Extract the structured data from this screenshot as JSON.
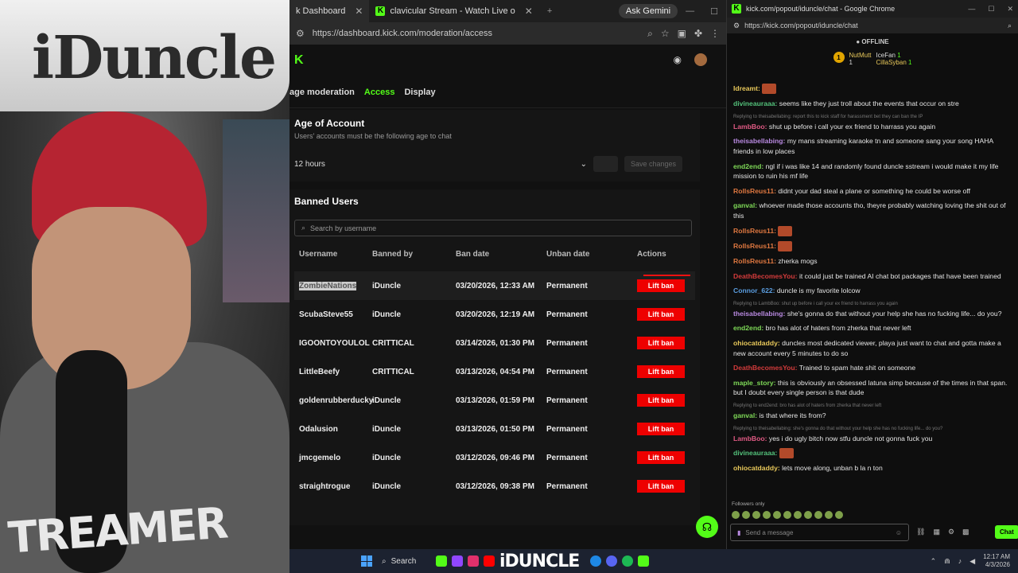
{
  "webcam": {
    "cap_text": "iDuncle",
    "shirt_text": "TREAMER"
  },
  "browser1": {
    "tabs": [
      {
        "label": "k Dashboard"
      },
      {
        "label": "clavicular Stream - Watch Live o"
      }
    ],
    "gemini_label": "Ask Gemini",
    "url": "https://dashboard.kick.com/moderation/access",
    "subnav": {
      "item1": "age moderation",
      "item2": "Access",
      "item3": "Display"
    },
    "age": {
      "title": "Age of Account",
      "desc": "Users' accounts must be the following age to chat",
      "value": "12 hours",
      "save_label": "Save changes"
    },
    "banned": {
      "title": "Banned Users",
      "search_placeholder": "Search by username",
      "headers": {
        "username": "Username",
        "banned_by": "Banned by",
        "ban_date": "Ban date",
        "unban_date": "Unban date",
        "actions": "Actions"
      },
      "rows": [
        {
          "username": "ZombieNations",
          "by": "iDuncle",
          "date": "03/20/2026, 12:33 AM",
          "unban": "Permanent",
          "action": "Lift ban"
        },
        {
          "username": "ScubaSteve55",
          "by": "iDuncle",
          "date": "03/20/2026, 12:19 AM",
          "unban": "Permanent",
          "action": "Lift ban"
        },
        {
          "username": "IGOONTOYOULOL",
          "by": "CRITTICAL",
          "date": "03/14/2026, 01:30 PM",
          "unban": "Permanent",
          "action": "Lift ban"
        },
        {
          "username": "LittleBeefy",
          "by": "CRITTICAL",
          "date": "03/13/2026, 04:54 PM",
          "unban": "Permanent",
          "action": "Lift ban"
        },
        {
          "username": "goldenrubberducky",
          "by": "iDuncle",
          "date": "03/13/2026, 01:59 PM",
          "unban": "Permanent",
          "action": "Lift ban"
        },
        {
          "username": "Odalusion",
          "by": "iDuncle",
          "date": "03/13/2026, 01:50 PM",
          "unban": "Permanent",
          "action": "Lift ban"
        },
        {
          "username": "jmcgemelo",
          "by": "iDuncle",
          "date": "03/12/2026, 09:46 PM",
          "unban": "Permanent",
          "action": "Lift ban"
        },
        {
          "username": "straightrogue",
          "by": "iDuncle",
          "date": "03/12/2026, 09:38 PM",
          "unban": "Permanent",
          "action": "Lift ban"
        }
      ]
    }
  },
  "browser2": {
    "title": "kick.com/popout/iduncle/chat - Google Chrome",
    "url": "https://kick.com/popout/iduncle/chat",
    "status": "OFFLINE",
    "gifters": {
      "g1": "NutMutt",
      "g1_count": "1",
      "g2": "IceFan",
      "g2_count": "1",
      "g3": "CillaSyban",
      "g3_count": "1"
    },
    "messages": [
      {
        "reply": "",
        "user": "Idreamt:",
        "text": "",
        "cls": "cu1"
      },
      {
        "reply": "",
        "user": "divineauraaa:",
        "text": "seems like they just troll about the events that occur on stre",
        "cls": "cu2"
      },
      {
        "reply": "Replying to theisabellabing: report this to kick staff for harassment bet they can ban the IP",
        "user": "LambBoo:",
        "text": "shut up before i call your ex friend to harrass you again",
        "cls": "cu3"
      },
      {
        "reply": "",
        "user": "theisabellabing:",
        "text": "my mans streaming karaoke tn and someone sang your song HAHA friends in low places",
        "cls": "cu4"
      },
      {
        "reply": "",
        "user": "end2end:",
        "text": "ngl if i was like 14 and randomly found duncle sstream i would make it my life mission to ruin his mf life",
        "cls": "cu5"
      },
      {
        "reply": "",
        "user": "RollsReus11:",
        "text": "didnt your dad steal a plane or something he could be worse off",
        "cls": "cu6"
      },
      {
        "reply": "",
        "user": "ganval:",
        "text": "whoever made those accounts tho, theyre probably watching loving the shit out of this",
        "cls": "cu5"
      },
      {
        "reply": "",
        "user": "RollsReus11:",
        "text": "",
        "cls": "cu6"
      },
      {
        "reply": "",
        "user": "RollsReus11:",
        "text": "",
        "cls": "cu6"
      },
      {
        "reply": "",
        "user": "RollsReus11:",
        "text": "zherka mogs",
        "cls": "cu6"
      },
      {
        "reply": "",
        "user": "DeathBecomesYou:",
        "text": "it could just be trained AI chat bot packages that have been trained",
        "cls": "cu7"
      },
      {
        "reply": "",
        "user": "Connor_622:",
        "text": "duncle is my favorite lolcow",
        "cls": "cu8"
      },
      {
        "reply": "Replying to LambBoo: shut up before i call your ex friend to harrass you again",
        "user": "theisabellabing:",
        "text": "she's gonna do that without your help she has no fucking life... do you?",
        "cls": "cu4"
      },
      {
        "reply": "",
        "user": "end2end:",
        "text": "bro has alot of haters from zherka that never left",
        "cls": "cu5"
      },
      {
        "reply": "",
        "user": "ohiocatdaddy:",
        "text": "duncles most dedicated viewer, playa just want to chat and gotta make a new account every 5 minutes to do so",
        "cls": "cu1"
      },
      {
        "reply": "",
        "user": "DeathBecomesYou:",
        "text": "Trained to spam hate shit on someone",
        "cls": "cu7"
      },
      {
        "reply": "",
        "user": "maple_story:",
        "text": "this is obviously an obsessed latuna simp because of the times in that span. but I doubt every single person is that dude",
        "cls": "cu5"
      },
      {
        "reply": "Replying to end2end: bro has alot of haters from zherka that never left",
        "user": "ganval:",
        "text": "is that where its from?",
        "cls": "cu5"
      },
      {
        "reply": "Replying to theisabellabing: she's gonna do that without your help she has no fucking life... do you?",
        "user": "LambBoo:",
        "text": "yes i do ugly bitch now stfu duncle not gonna fuck you",
        "cls": "cu3"
      },
      {
        "reply": "",
        "user": "divineauraaa:",
        "text": "",
        "cls": "cu2"
      },
      {
        "reply": "",
        "user": "ohiocatdaddy:",
        "text": "lets move along, unban b la n ton",
        "cls": "cu1"
      }
    ],
    "followers_only": "Followers only",
    "send_placeholder": "Send a message",
    "chat_button": "Chat"
  },
  "taskbar": {
    "search": "Search",
    "brand": "iDUNCLE",
    "time": "12:17 AM",
    "date": "4/3/2026"
  }
}
